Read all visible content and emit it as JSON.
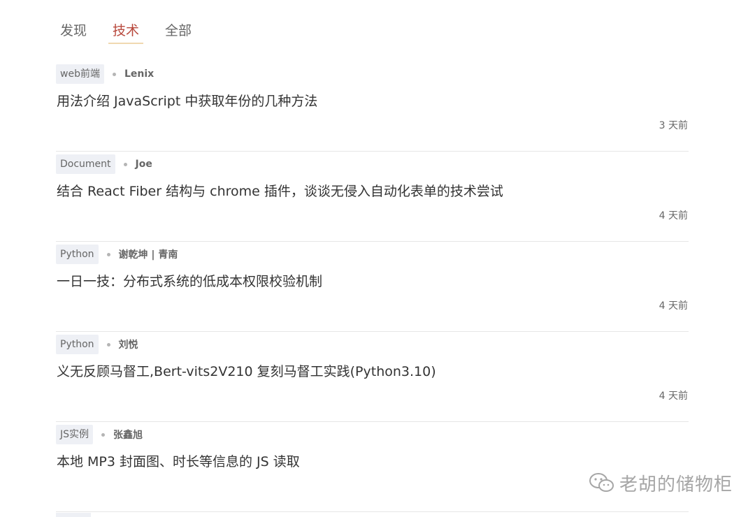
{
  "tabs": [
    {
      "label": "发现"
    },
    {
      "label": "技术"
    },
    {
      "label": "全部"
    }
  ],
  "articles": [
    {
      "tag": "web前端",
      "author": "Lenix",
      "title": "用法介绍 JavaScript 中获取年份的几种方法",
      "time": "3 天前"
    },
    {
      "tag": "Document",
      "author": "Joe",
      "title": "结合 React Fiber 结构与 chrome 插件，谈谈无侵入自动化表单的技术尝试",
      "time": "4 天前"
    },
    {
      "tag": "Python",
      "author": "谢乾坤 | 青南",
      "title": "一日一技：分布式系统的低成本权限校验机制",
      "time": "4 天前"
    },
    {
      "tag": "Python",
      "author": "刘悦",
      "title": "义无反顾马督工,Bert-vits2V210 复刻马督工实践(Python3.10)",
      "time": "4 天前"
    },
    {
      "tag": "JS实例",
      "author": "张鑫旭",
      "title": "本地 MP3 封面图、时长等信息的 JS 读取",
      "time": ""
    }
  ],
  "watermark": {
    "text": "老胡的储物柜",
    "icon": "wechat-icon"
  }
}
